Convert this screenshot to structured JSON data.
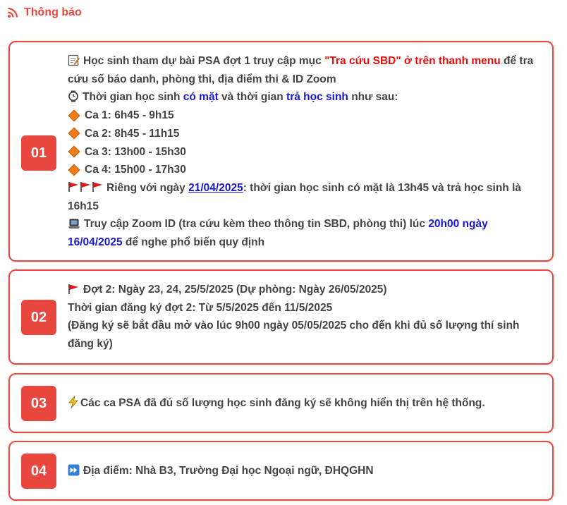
{
  "header": {
    "title": "Thông báo"
  },
  "cards": [
    {
      "number": "01",
      "lines": {
        "l1_pre": "Học sinh tham dự bài PSA đợt 1 truy cập mục ",
        "l1_red": "\"Tra cứu SBD\" ở trên thanh menu",
        "l1_post": " để tra cứu số báo danh, phòng thi, địa điểm thi & ID Zoom",
        "l2_pre": "Thời gian học sinh ",
        "l2_blue1": "có mặt",
        "l2_mid": " và thời gian ",
        "l2_blue2": "trả học sinh",
        "l2_post": " như sau:",
        "shifts": [
          "Ca 1: 6h45 - 9h15",
          "Ca 2: 8h45 - 11h15",
          "Ca 3: 13h00 - 15h30",
          "Ca 4: 15h00 - 17h30"
        ],
        "l7_pre": "Riêng với ngày ",
        "l7_link": "21/04/2025",
        "l7_post": ": thời gian học sinh có mặt là 13h45 và trả học sinh là 16h15",
        "l8_pre": "Truy cập Zoom ID (tra cứu kèm theo thông tin SBD, phòng thi) lúc ",
        "l8_blue": "20h00 ngày 16/04/2025",
        "l8_post": " để nghe phổ biến quy định"
      }
    },
    {
      "number": "02",
      "lines": {
        "l1": "Đợt 2: Ngày 23, 24, 25/5/2025 (Dự phòng: Ngày 26/05/2025)",
        "l2": "Thời gian đăng ký đợt 2: Từ 5/5/2025 đến 11/5/2025",
        "l3": "(Đăng ký sẽ bắt đầu mở vào lúc 9h00 ngày 05/05/2025 cho đến khi đủ số lượng thí sinh đăng ký)"
      }
    },
    {
      "number": "03",
      "lines": {
        "l1": "Các ca PSA đã đủ số lượng học sinh đăng ký sẽ không hiển thị trên hệ thống."
      }
    },
    {
      "number": "04",
      "lines": {
        "l1": "Địa điểm: Nhà B3, Trường Đại học Ngoại ngữ, ĐHQGHN"
      }
    }
  ],
  "colors": {
    "accent": "#e8473f",
    "red_text": "#ea0c0c",
    "blue_text": "#1717d6"
  },
  "icons": [
    "rss-icon",
    "memo-icon",
    "watch-icon",
    "orange-diamond-icon",
    "red-flag-icon",
    "laptop-icon",
    "lightning-icon",
    "fast-forward-icon"
  ]
}
